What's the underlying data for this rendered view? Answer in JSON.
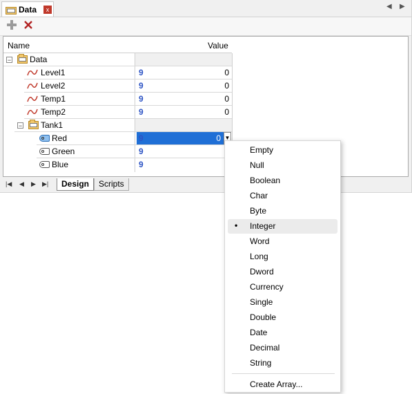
{
  "window": {
    "tab_title": "Data",
    "close_glyph": "x",
    "nav_left": "◀",
    "nav_right": "▶"
  },
  "toolbar": {
    "add_icon": "plus-icon",
    "delete_icon": "delete-x-icon"
  },
  "grid": {
    "col_name": "Name",
    "col_value": "Value",
    "root": "Data",
    "rows": [
      {
        "label": "Level1",
        "type_badge": "9",
        "value": "0"
      },
      {
        "label": "Level2",
        "type_badge": "9",
        "value": "0"
      },
      {
        "label": "Temp1",
        "type_badge": "9",
        "value": "0"
      },
      {
        "label": "Temp2",
        "type_badge": "9",
        "value": "0"
      }
    ],
    "group": "Tank1",
    "group_rows": [
      {
        "label": "Red",
        "type_badge": "9",
        "value": "0"
      },
      {
        "label": "Green",
        "type_badge": "9"
      },
      {
        "label": "Blue",
        "type_badge": "9"
      }
    ]
  },
  "bottom_tabs": {
    "design": "Design",
    "scripts": "Scripts"
  },
  "type_menu": {
    "items": [
      "Empty",
      "Null",
      "Boolean",
      "Char",
      "Byte",
      "Integer",
      "Word",
      "Long",
      "Dword",
      "Currency",
      "Single",
      "Double",
      "Date",
      "Decimal",
      "String"
    ],
    "selected": "Integer",
    "bullet": "•",
    "create_array": "Create Array..."
  },
  "colors": {
    "accent": "#1f6fd6",
    "value_blue": "#2c53c4",
    "delete_red": "#c0392b"
  }
}
